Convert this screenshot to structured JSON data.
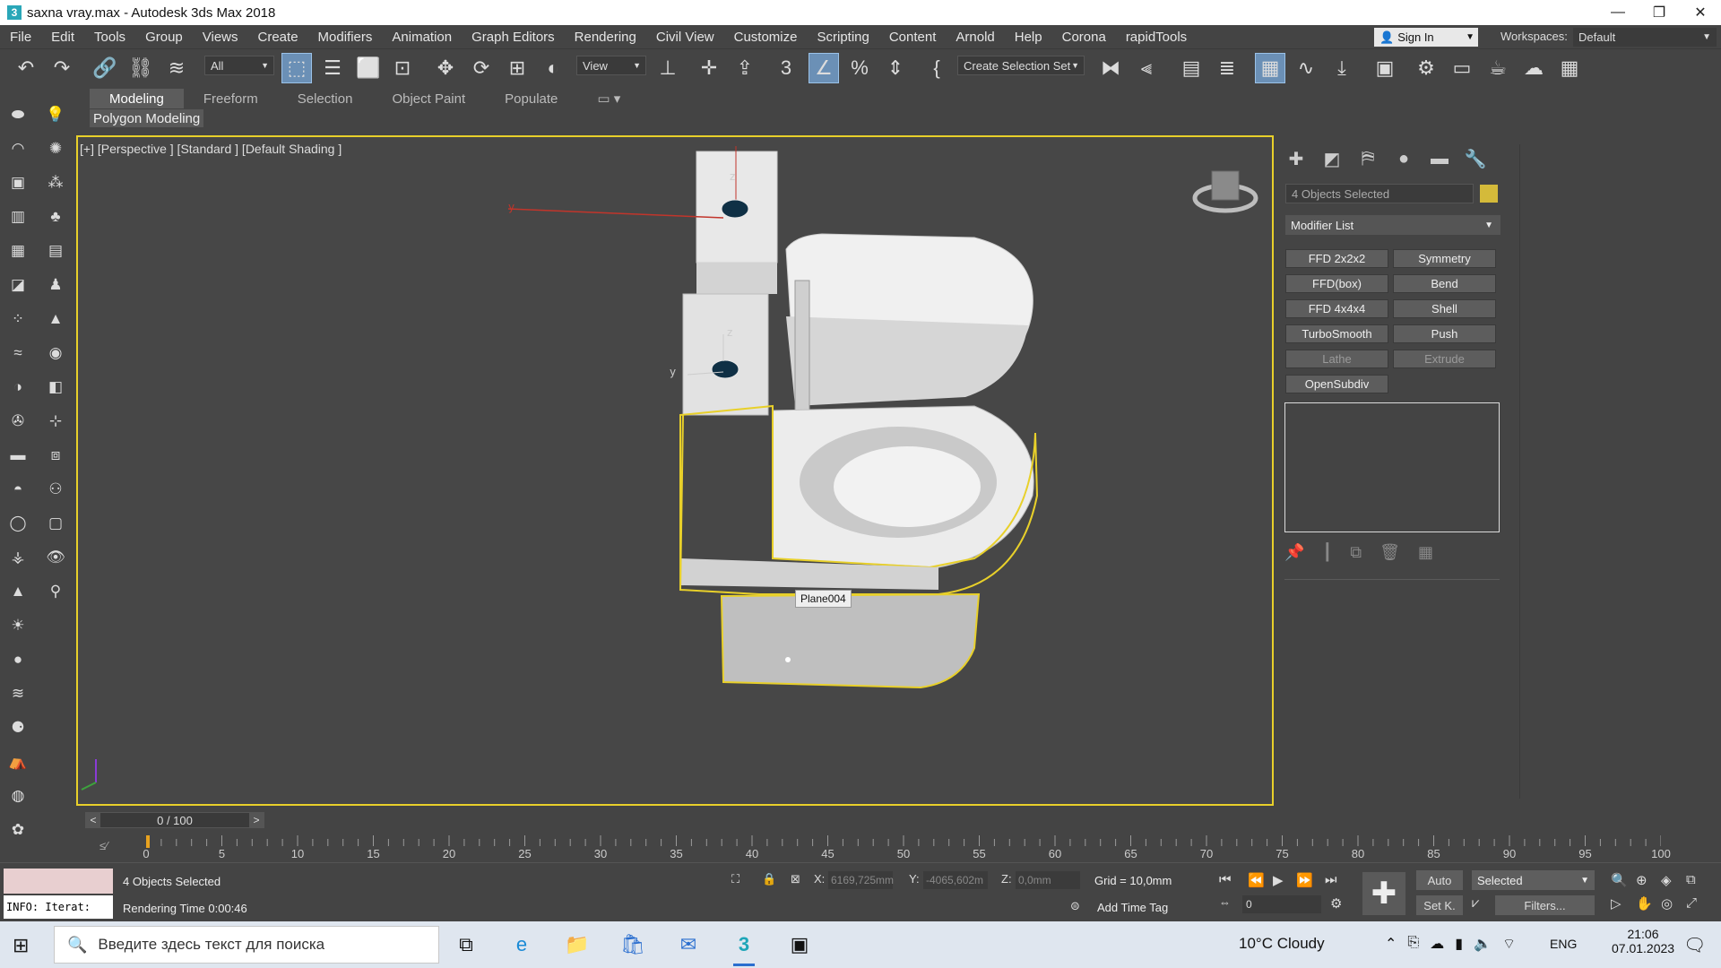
{
  "window": {
    "title": "saxna vray.max - Autodesk 3ds Max 2018",
    "app_icon": "3",
    "minimize": "—",
    "maximize": "❐",
    "close": "✕"
  },
  "menu": {
    "items": [
      "File",
      "Edit",
      "Tools",
      "Group",
      "Views",
      "Create",
      "Modifiers",
      "Animation",
      "Graph Editors",
      "Rendering",
      "Civil View",
      "Customize",
      "Scripting",
      "Content",
      "Arnold",
      "Help",
      "Corona",
      "rapidTools"
    ],
    "sign_in": "Sign In",
    "workspaces_label": "Workspaces:",
    "workspace_value": "Default"
  },
  "toolbar": {
    "filter_value": "All",
    "refcoord_value": "View",
    "selection_set": "Create Selection Set"
  },
  "ribbon": {
    "tabs": [
      "Modeling",
      "Freeform",
      "Selection",
      "Object Paint",
      "Populate"
    ],
    "active_tab": "Modeling",
    "sub_label": "Polygon Modeling"
  },
  "viewport": {
    "label": "[+] [Perspective ] [Standard ] [Default Shading ]",
    "object_tag": "Plane004",
    "axis_x": "x",
    "axis_y": "y",
    "axis_z": "z"
  },
  "command_panel": {
    "selection_name": "4 Objects Selected",
    "selection_color": "#d4ba3a",
    "modifier_list": "Modifier List",
    "modifier_buttons": [
      {
        "label": "FFD 2x2x2",
        "enabled": true
      },
      {
        "label": "Symmetry",
        "enabled": true
      },
      {
        "label": "FFD(box)",
        "enabled": true
      },
      {
        "label": "Bend",
        "enabled": true
      },
      {
        "label": "FFD 4x4x4",
        "enabled": true
      },
      {
        "label": "Shell",
        "enabled": true
      },
      {
        "label": "TurboSmooth",
        "enabled": true
      },
      {
        "label": "Push",
        "enabled": true
      },
      {
        "label": "Lathe",
        "enabled": false
      },
      {
        "label": "Extrude",
        "enabled": false
      },
      {
        "label": "OpenSubdiv",
        "enabled": true
      }
    ]
  },
  "timeline": {
    "frame_display": "0 / 100",
    "prev": "<",
    "next": ">",
    "ticks": [
      "0",
      "5",
      "10",
      "15",
      "20",
      "25",
      "30",
      "35",
      "40",
      "45",
      "50",
      "55",
      "60",
      "65",
      "70",
      "75",
      "80",
      "85",
      "90",
      "95",
      "100"
    ]
  },
  "status": {
    "maxscript_info": "INFO: Iterat:",
    "selection_status": "4 Objects Selected",
    "prompt": "Rendering Time  0:00:46",
    "x_label": "X:",
    "x_value": "6169,725mm",
    "y_label": "Y:",
    "y_value": "-4065,602m",
    "z_label": "Z:",
    "z_value": "0,0mm",
    "grid": "Grid = 10,0mm",
    "add_time_tag": "Add Time Tag",
    "auto_key": "Auto",
    "set_key": "Set K.",
    "key_filter_value": "Selected",
    "filters": "Filters...",
    "current_frame": "0"
  },
  "taskbar": {
    "search_placeholder": "Введите здесь текст для поиска",
    "weather": "10°C  Cloudy",
    "language": "ENG",
    "time": "21:06",
    "date": "07.01.2023"
  }
}
